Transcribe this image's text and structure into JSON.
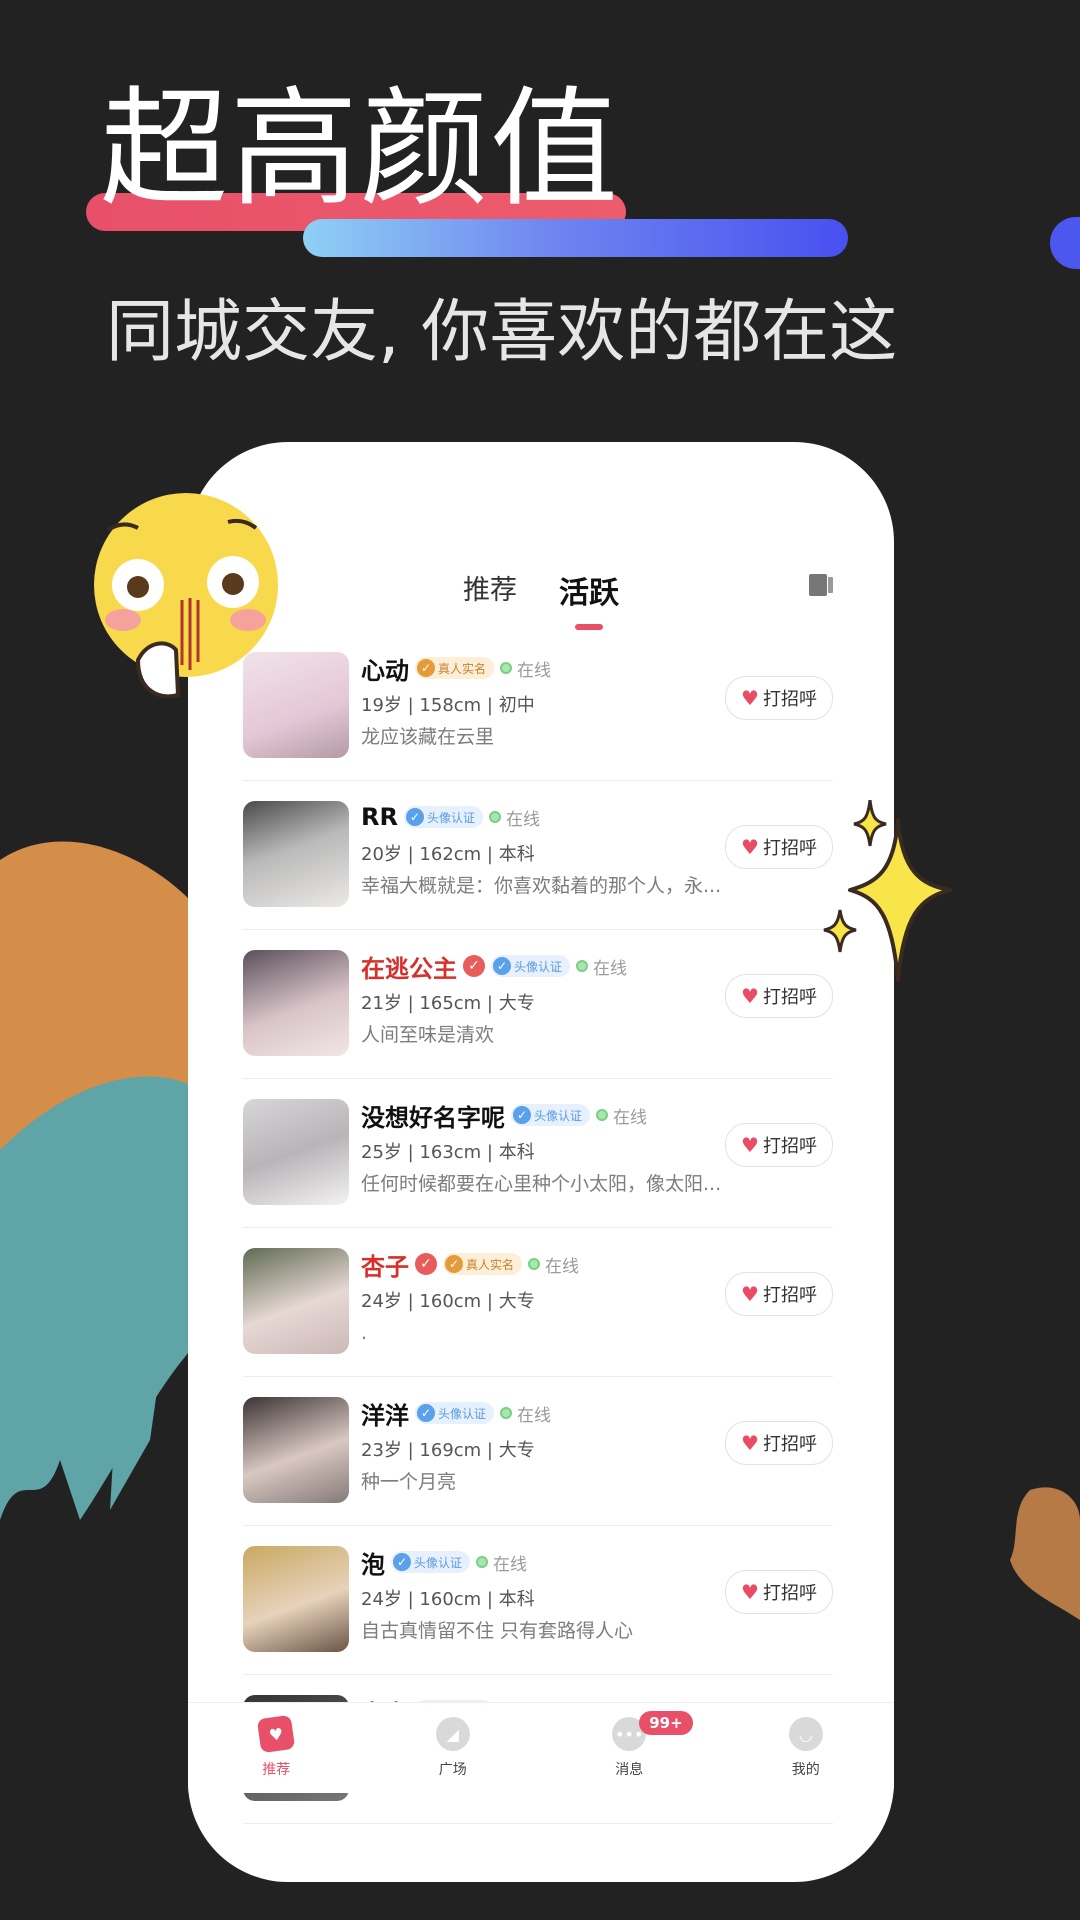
{
  "promo": {
    "headline": "超高颜值",
    "subline": "同城交友, 你喜欢的都在这"
  },
  "tabs": [
    {
      "label": "推荐",
      "active": false
    },
    {
      "label": "活跃",
      "active": true
    }
  ],
  "users": [
    {
      "name": "心动",
      "name_red": false,
      "vip": false,
      "badge": "真人实名",
      "badge_type": "real",
      "status": "在线",
      "meta": "19岁 | 158cm | 初中",
      "bio": "龙应该藏在云里",
      "greet": "打招呼"
    },
    {
      "name": "RR",
      "name_red": false,
      "vip": false,
      "badge": "头像认证",
      "badge_type": "avatar",
      "status": "在线",
      "meta": "20岁 | 162cm | 本科",
      "bio": "幸福大概就是：你喜欢黏着的那个人，永...",
      "greet": "打招呼"
    },
    {
      "name": "在逃公主",
      "name_red": true,
      "vip": true,
      "badge": "头像认证",
      "badge_type": "avatar",
      "status": "在线",
      "meta": "21岁 | 165cm | 大专",
      "bio": "人间至味是清欢",
      "greet": "打招呼"
    },
    {
      "name": "没想好名字呢",
      "name_red": false,
      "vip": false,
      "badge": "头像认证",
      "badge_type": "avatar",
      "status": "在线",
      "meta": "25岁 | 163cm | 本科",
      "bio": "任何时候都要在心里种个小太阳，像太阳...",
      "greet": "打招呼"
    },
    {
      "name": "杏子",
      "name_red": true,
      "vip": true,
      "badge": "真人实名",
      "badge_type": "real",
      "status": "在线",
      "meta": "24岁 | 160cm | 大专",
      "bio": ".",
      "greet": "打招呼"
    },
    {
      "name": "洋洋",
      "name_red": false,
      "vip": false,
      "badge": "头像认证",
      "badge_type": "avatar",
      "status": "在线",
      "meta": "23岁 | 169cm | 大专",
      "bio": "种一个月亮",
      "greet": "打招呼"
    },
    {
      "name": "泡",
      "name_red": false,
      "vip": false,
      "badge": "头像认证",
      "badge_type": "avatar",
      "status": "在线",
      "meta": "24岁 | 160cm | 本科",
      "bio": "自古真情留不住   只有套路得人心",
      "greet": "打招呼"
    },
    {
      "name": "安安",
      "name_red": false,
      "vip": false,
      "badge": "头像认证",
      "badge_type": "avatar",
      "status": "在线",
      "meta": "",
      "bio": "",
      "greet": ""
    }
  ],
  "nav": [
    {
      "label": "推荐",
      "icon": "heart-cards-icon",
      "active": true
    },
    {
      "label": "广场",
      "icon": "compass-icon",
      "active": false
    },
    {
      "label": "消息",
      "icon": "chat-bubble-icon",
      "active": false,
      "badge": "99+"
    },
    {
      "label": "我的",
      "icon": "profile-icon",
      "active": false
    }
  ],
  "colors": {
    "background": "#232223",
    "accent": "#e8506a",
    "highlight_blue": "#4850f0",
    "name_red": "#d7302c",
    "online_green": "#77d083"
  }
}
